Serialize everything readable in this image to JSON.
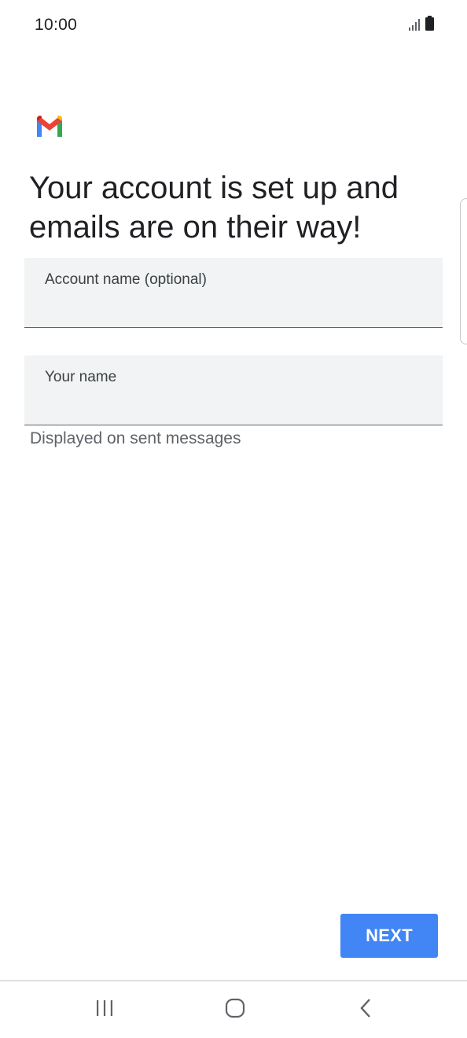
{
  "status_bar": {
    "time": "10:00",
    "signal_icon": "signal-icon",
    "battery_icon": "battery-icon"
  },
  "app": {
    "logo_icon": "gmail-logo-icon"
  },
  "headline": "Your account is set up and emails are on their way!",
  "form": {
    "account_name": {
      "label": "Account name (optional)",
      "value": ""
    },
    "your_name": {
      "label": "Your name",
      "value": "",
      "helper": "Displayed on sent messages"
    }
  },
  "actions": {
    "next_label": "NEXT"
  },
  "navigation": {
    "recents_icon": "recents-icon",
    "home_icon": "home-icon",
    "back_icon": "back-icon"
  },
  "colors": {
    "accent": "#4285f4",
    "field_background": "#f1f3f4",
    "text_primary": "#202124",
    "text_secondary": "#5f6368"
  }
}
